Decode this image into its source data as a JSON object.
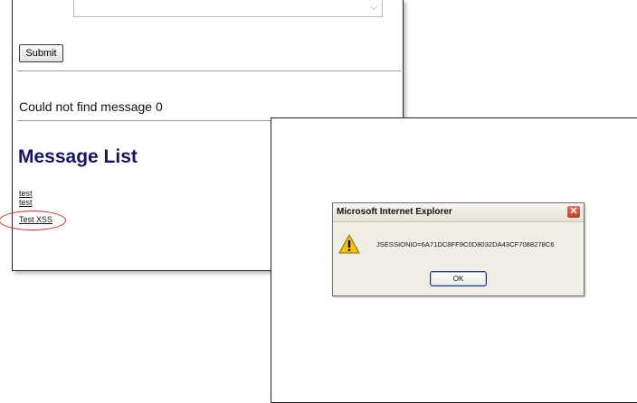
{
  "back_page": {
    "submit_label": "Submit",
    "status_message": "Could not find message 0",
    "heading": "Message List",
    "messages": [
      "test",
      "test",
      "Test XSS"
    ]
  },
  "dialog": {
    "title": "Microsoft Internet Explorer",
    "close_glyph": "✕",
    "message": "JSESSIONID=6A71DC8FF9C0D8032DA43CF7088278C6",
    "ok_label": "OK"
  },
  "colors": {
    "heading": "#14146b",
    "highlight_circle": "#dd2222",
    "close_button": "#c83b1d"
  },
  "icons": {
    "dialog_icon": "warning-icon",
    "scroll": "chevron-down-icon"
  }
}
